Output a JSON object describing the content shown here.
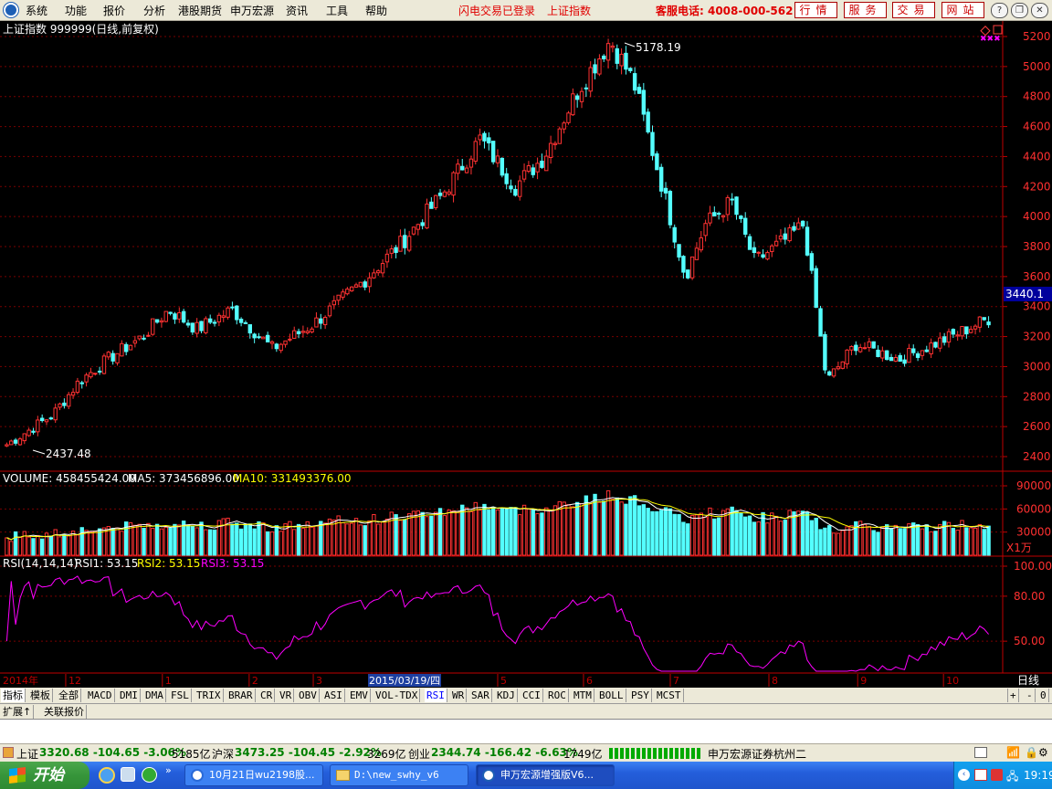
{
  "menubar": {
    "items": [
      "系统",
      "功能",
      "报价",
      "分析",
      "港股期货",
      "申万宏源",
      "资讯",
      "工具",
      "帮助"
    ],
    "status_login": "闪电交易已登录",
    "status_index": "上证指数",
    "hotline": "客服电话: 4008-000-562",
    "buttons": [
      "行情",
      "服务",
      "交易",
      "网站"
    ]
  },
  "main_chart": {
    "title": "上证指数 999999(日线,前复权)",
    "high_label": "5178.19",
    "low_label": "2437.48",
    "current_price": "3440.1",
    "y_ticks": [
      "5200",
      "5000",
      "4800",
      "4600",
      "4400",
      "4200",
      "4000",
      "3800",
      "3600",
      "3400",
      "3200",
      "3000",
      "2800",
      "2600",
      "2400"
    ]
  },
  "volume_chart": {
    "label_volume": "VOLUME: 458455424.00",
    "label_ma5": "MA5: 373456896.00",
    "label_ma10": "MA10: 331493376.00",
    "y_ticks": [
      "90000",
      "60000",
      "30000"
    ],
    "unit": "X1万"
  },
  "rsi_chart": {
    "label_params": "RSI(14,14,14)",
    "label_rsi1": "RSI1: 53.15",
    "label_rsi2": "RSI2: 53.15",
    "label_rsi3": "RSI3: 53.15",
    "y_ticks": [
      "100.00",
      "80.00",
      "50.00"
    ]
  },
  "time_axis": {
    "start_label": "2014年",
    "months": [
      "12",
      "1",
      "2",
      "3",
      "5",
      "6",
      "7",
      "8",
      "9",
      "10"
    ],
    "cursor_date": "2015/03/19/四",
    "period": "日线"
  },
  "indicator_tabs": {
    "left": [
      "指标",
      "模板",
      "全部"
    ],
    "items": [
      "MACD",
      "DMI",
      "DMA",
      "FSL",
      "TRIX",
      "BRAR",
      "CR",
      "VR",
      "OBV",
      "ASI",
      "EMV",
      "VOL-TDX",
      "RSI",
      "WR",
      "SAR",
      "KDJ",
      "CCI",
      "ROC",
      "MTM",
      "BOLL",
      "PSY",
      "MCST"
    ],
    "selected": "RSI",
    "right_controls": [
      "+",
      "-",
      "0"
    ]
  },
  "sub_tabs": [
    "扩展↑",
    "关联报价"
  ],
  "status_bar": {
    "sh_name": "上证",
    "sh_value": "3320.68 -104.65 -3.06%",
    "sh_amount": "5185亿",
    "hs_name": "沪深",
    "hs_value": "3473.25 -104.45 -2.92%",
    "hs_amount": "3269亿",
    "cy_name": "创业",
    "cy_value": "2344.74 -166.42 -6.63%",
    "cy_amount": "1749亿",
    "broker": "申万宏源证券杭州二"
  },
  "taskbar": {
    "start_label": "开始",
    "tasks": [
      "10月21日wu2198股...",
      "D:\\new_swhy_v6",
      "申万宏源增强版V6..."
    ],
    "clock": "19:19"
  },
  "chart_data": {
    "type": "candlestick",
    "title": "上证指数 999999(日线,前复权)",
    "x_range": [
      "2014-11",
      "2015-10"
    ],
    "ylim": [
      2400,
      5200
    ],
    "price_path": [
      {
        "date": "2014-11",
        "close": 2480
      },
      {
        "date": "2014-12-01",
        "close": 2680
      },
      {
        "date": "2014-12-10",
        "close": 2900
      },
      {
        "date": "2014-12-20",
        "close": 3050
      },
      {
        "date": "2015-01-01",
        "close": 3200
      },
      {
        "date": "2015-01-10",
        "close": 3380
      },
      {
        "date": "2015-01-20",
        "close": 3250
      },
      {
        "date": "2015-02-01",
        "close": 3380
      },
      {
        "date": "2015-02-15",
        "close": 3120
      },
      {
        "date": "2015-03-01",
        "close": 3280
      },
      {
        "date": "2015-03-19",
        "close": 3580
      },
      {
        "date": "2015-04-01",
        "close": 3830
      },
      {
        "date": "2015-04-15",
        "close": 4150
      },
      {
        "date": "2015-04-28",
        "close": 4520
      },
      {
        "date": "2015-05-10",
        "close": 4200
      },
      {
        "date": "2015-05-20",
        "close": 4400
      },
      {
        "date": "2015-06-01",
        "close": 4850
      },
      {
        "date": "2015-06-12",
        "close": 5178
      },
      {
        "date": "2015-06-20",
        "close": 4900
      },
      {
        "date": "2015-06-30",
        "close": 4200
      },
      {
        "date": "2015-07-08",
        "close": 3600
      },
      {
        "date": "2015-07-15",
        "close": 3950
      },
      {
        "date": "2015-07-24",
        "close": 4100
      },
      {
        "date": "2015-08-01",
        "close": 3700
      },
      {
        "date": "2015-08-12",
        "close": 3850
      },
      {
        "date": "2015-08-18",
        "close": 3950
      },
      {
        "date": "2015-08-26",
        "close": 2900
      },
      {
        "date": "2015-09-05",
        "close": 3150
      },
      {
        "date": "2015-09-20",
        "close": 3050
      },
      {
        "date": "2015-10-08",
        "close": 3200
      },
      {
        "date": "2015-10-21",
        "close": 3320
      }
    ],
    "high": 5178.19,
    "low": 2437.48,
    "last": 3440.1,
    "volume": {
      "value": 458455424.0,
      "ma5": 373456896.0,
      "ma10": 331493376.0,
      "ylim": [
        0,
        90000
      ]
    },
    "rsi": {
      "rsi1": 53.15,
      "rsi2": 53.15,
      "rsi3": 53.15,
      "ylim": [
        30,
        100
      ]
    }
  }
}
